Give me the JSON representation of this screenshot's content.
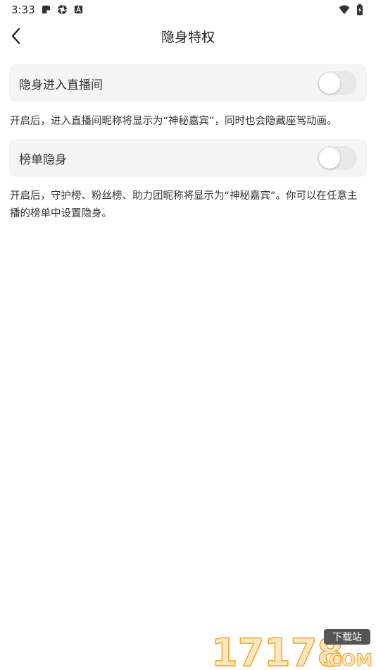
{
  "status_bar": {
    "time": "3:33",
    "left_icons": [
      "notification-app-icon",
      "aperture-icon",
      "a-icon"
    ],
    "right_icons": [
      "wifi-icon",
      "battery-charging-icon"
    ]
  },
  "header": {
    "title": "隐身特权",
    "back_icon": "chevron-left-icon"
  },
  "settings": [
    {
      "label": "隐身进入直播间",
      "enabled": false,
      "description": "开启后，进入直播间昵称将显示为“神秘嘉宾”，同时也会隐藏座驾动画。"
    },
    {
      "label": "榜单隐身",
      "enabled": false,
      "description": "开启后，守护榜、粉丝榜、助力团昵称将显示为“神秘嘉宾”。你可以在任意主播的榜单中设置隐身。"
    }
  ],
  "watermark": {
    "number": "17178",
    "tag": "下载站",
    "domain": ".COM"
  },
  "colors": {
    "card_bg": "#f5f5f5",
    "toggle_off": "#e8e8e8",
    "watermark_orange": "#f5a623"
  }
}
